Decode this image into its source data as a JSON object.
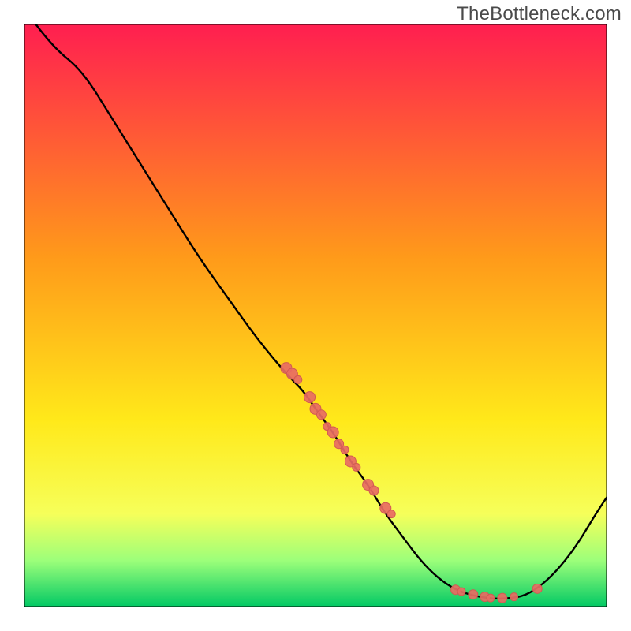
{
  "watermark": "TheBottleneck.com",
  "colors": {
    "gradient_top": "#ff1e50",
    "gradient_mid1": "#ff9a1a",
    "gradient_mid2": "#ffe91a",
    "gradient_bottom_yellow": "#f6ff5a",
    "gradient_green_light": "#9cff7a",
    "gradient_green": "#00c864",
    "curve": "#000000",
    "dot_fill": "#e86b63",
    "dot_stroke": "#d25a52",
    "frame": "#000000"
  },
  "chart_data": {
    "type": "line",
    "title": "",
    "xlabel": "",
    "ylabel": "",
    "xlim": [
      0,
      100
    ],
    "ylim": [
      0,
      100
    ],
    "grid": false,
    "legend": false,
    "curve": [
      {
        "x": 2,
        "y": 100
      },
      {
        "x": 5,
        "y": 96
      },
      {
        "x": 10,
        "y": 92
      },
      {
        "x": 15,
        "y": 84
      },
      {
        "x": 20,
        "y": 76
      },
      {
        "x": 25,
        "y": 68
      },
      {
        "x": 30,
        "y": 60
      },
      {
        "x": 35,
        "y": 53
      },
      {
        "x": 40,
        "y": 46
      },
      {
        "x": 45,
        "y": 40
      },
      {
        "x": 48,
        "y": 37
      },
      {
        "x": 50,
        "y": 34
      },
      {
        "x": 53,
        "y": 30
      },
      {
        "x": 56,
        "y": 25
      },
      {
        "x": 59,
        "y": 21
      },
      {
        "x": 62,
        "y": 16
      },
      {
        "x": 65,
        "y": 12
      },
      {
        "x": 68,
        "y": 8
      },
      {
        "x": 71,
        "y": 5
      },
      {
        "x": 74,
        "y": 3
      },
      {
        "x": 77,
        "y": 2
      },
      {
        "x": 80,
        "y": 1.5
      },
      {
        "x": 83,
        "y": 1.5
      },
      {
        "x": 86,
        "y": 2
      },
      {
        "x": 89,
        "y": 4
      },
      {
        "x": 92,
        "y": 7
      },
      {
        "x": 95,
        "y": 11
      },
      {
        "x": 98,
        "y": 16
      },
      {
        "x": 100,
        "y": 19
      }
    ],
    "dot_clusters": [
      {
        "x": 45,
        "y": 41,
        "r": 7
      },
      {
        "x": 46,
        "y": 40,
        "r": 7
      },
      {
        "x": 47,
        "y": 39,
        "r": 5
      },
      {
        "x": 49,
        "y": 36,
        "r": 7
      },
      {
        "x": 50,
        "y": 34,
        "r": 7
      },
      {
        "x": 51,
        "y": 33,
        "r": 6
      },
      {
        "x": 52,
        "y": 31,
        "r": 5
      },
      {
        "x": 53,
        "y": 30,
        "r": 7
      },
      {
        "x": 54,
        "y": 28,
        "r": 6
      },
      {
        "x": 55,
        "y": 27,
        "r": 5
      },
      {
        "x": 56,
        "y": 25,
        "r": 7
      },
      {
        "x": 57,
        "y": 24,
        "r": 5
      },
      {
        "x": 59,
        "y": 21,
        "r": 7
      },
      {
        "x": 60,
        "y": 20,
        "r": 6
      },
      {
        "x": 62,
        "y": 17,
        "r": 7
      },
      {
        "x": 63,
        "y": 16,
        "r": 5
      },
      {
        "x": 74,
        "y": 3.0,
        "r": 6
      },
      {
        "x": 75,
        "y": 2.7,
        "r": 5
      },
      {
        "x": 77,
        "y": 2.2,
        "r": 6
      },
      {
        "x": 79,
        "y": 1.8,
        "r": 6
      },
      {
        "x": 80,
        "y": 1.6,
        "r": 5
      },
      {
        "x": 82,
        "y": 1.6,
        "r": 6
      },
      {
        "x": 84,
        "y": 1.8,
        "r": 5
      },
      {
        "x": 88,
        "y": 3.2,
        "r": 6
      }
    ],
    "background_gradient_stops": [
      {
        "offset": 0.0,
        "color_key": "gradient_top"
      },
      {
        "offset": 0.4,
        "color_key": "gradient_mid1"
      },
      {
        "offset": 0.68,
        "color_key": "gradient_mid2"
      },
      {
        "offset": 0.84,
        "color_key": "gradient_bottom_yellow"
      },
      {
        "offset": 0.92,
        "color_key": "gradient_green_light"
      },
      {
        "offset": 1.0,
        "color_key": "gradient_green"
      }
    ]
  }
}
